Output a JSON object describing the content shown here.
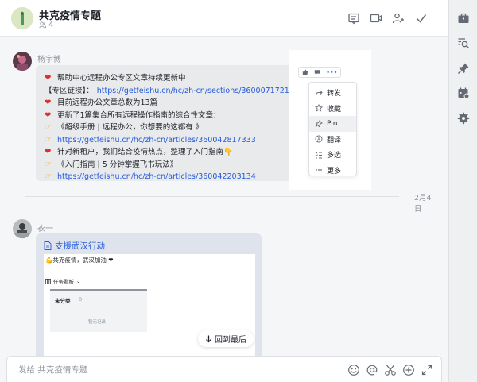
{
  "header": {
    "title": "共克疫情专题",
    "member_count": "4",
    "icons": [
      "announcement-icon",
      "video-call-icon",
      "add-member-icon",
      "checkmark-icon"
    ]
  },
  "sidebar_icons": [
    "briefcase-icon",
    "search-history-icon",
    "pin-icon",
    "calendar-icon",
    "settings-icon"
  ],
  "message1": {
    "sender": "杨宇博",
    "lines": [
      {
        "icon": "heart",
        "text": "帮助中心远程办公专区文章持续更新中",
        "link": ""
      },
      {
        "icon": "",
        "text": "【专区链接】：",
        "link": "https://getfeishu.cn/hc/zh-cn/sections/360007172153"
      },
      {
        "icon": "heart",
        "text": "目前远程办公文章总数为13篇",
        "link": ""
      },
      {
        "icon": "heart",
        "text": "更新了1篇集合所有远程操作指南的综合性文章：",
        "link": ""
      },
      {
        "icon": "point",
        "text": "《超级手册 | 远程办公，你想要的这都有 》",
        "link": ""
      },
      {
        "icon": "point",
        "text": "",
        "link": "https://getfeishu.cn/hc/zh-cn/articles/360042817333"
      },
      {
        "icon": "heart",
        "text": "针对新租户，我们结合疫情热点，整理了入门指南👇",
        "link": ""
      },
      {
        "icon": "point",
        "text": "《入门指南 | 5 分钟掌握飞书玩法》",
        "link": ""
      },
      {
        "icon": "point",
        "text": "",
        "link": "https://getfeishu.cn/hc/zh-cn/articles/360042203134"
      }
    ]
  },
  "context_menu": {
    "items": [
      {
        "label": "转发",
        "icon": "forward-icon"
      },
      {
        "label": "收藏",
        "icon": "star-icon"
      },
      {
        "label": "Pin",
        "icon": "pin-icon"
      },
      {
        "label": "翻译",
        "icon": "translate-icon"
      },
      {
        "label": "多选",
        "icon": "multi-select-icon"
      },
      {
        "label": "更多",
        "icon": "more-icon"
      }
    ],
    "hovered_item": "Pin"
  },
  "date_divider": "2月4日",
  "message2": {
    "sender": "衣一",
    "doc_title": "支援武汉行动",
    "doc_line": "💪共克疫情，武汉加油 ❤",
    "board_name": "任务看板",
    "column_name": "未分类",
    "column_count": "0",
    "empty_text": "暂无记录"
  },
  "back_to_latest": "回到最后",
  "composer": {
    "placeholder": "发给 共克疫情专题"
  },
  "colors": {
    "link": "#245bdb",
    "heart": "#e02d2d",
    "background": "#f5f6f7",
    "bubble": "#e9eaec"
  }
}
